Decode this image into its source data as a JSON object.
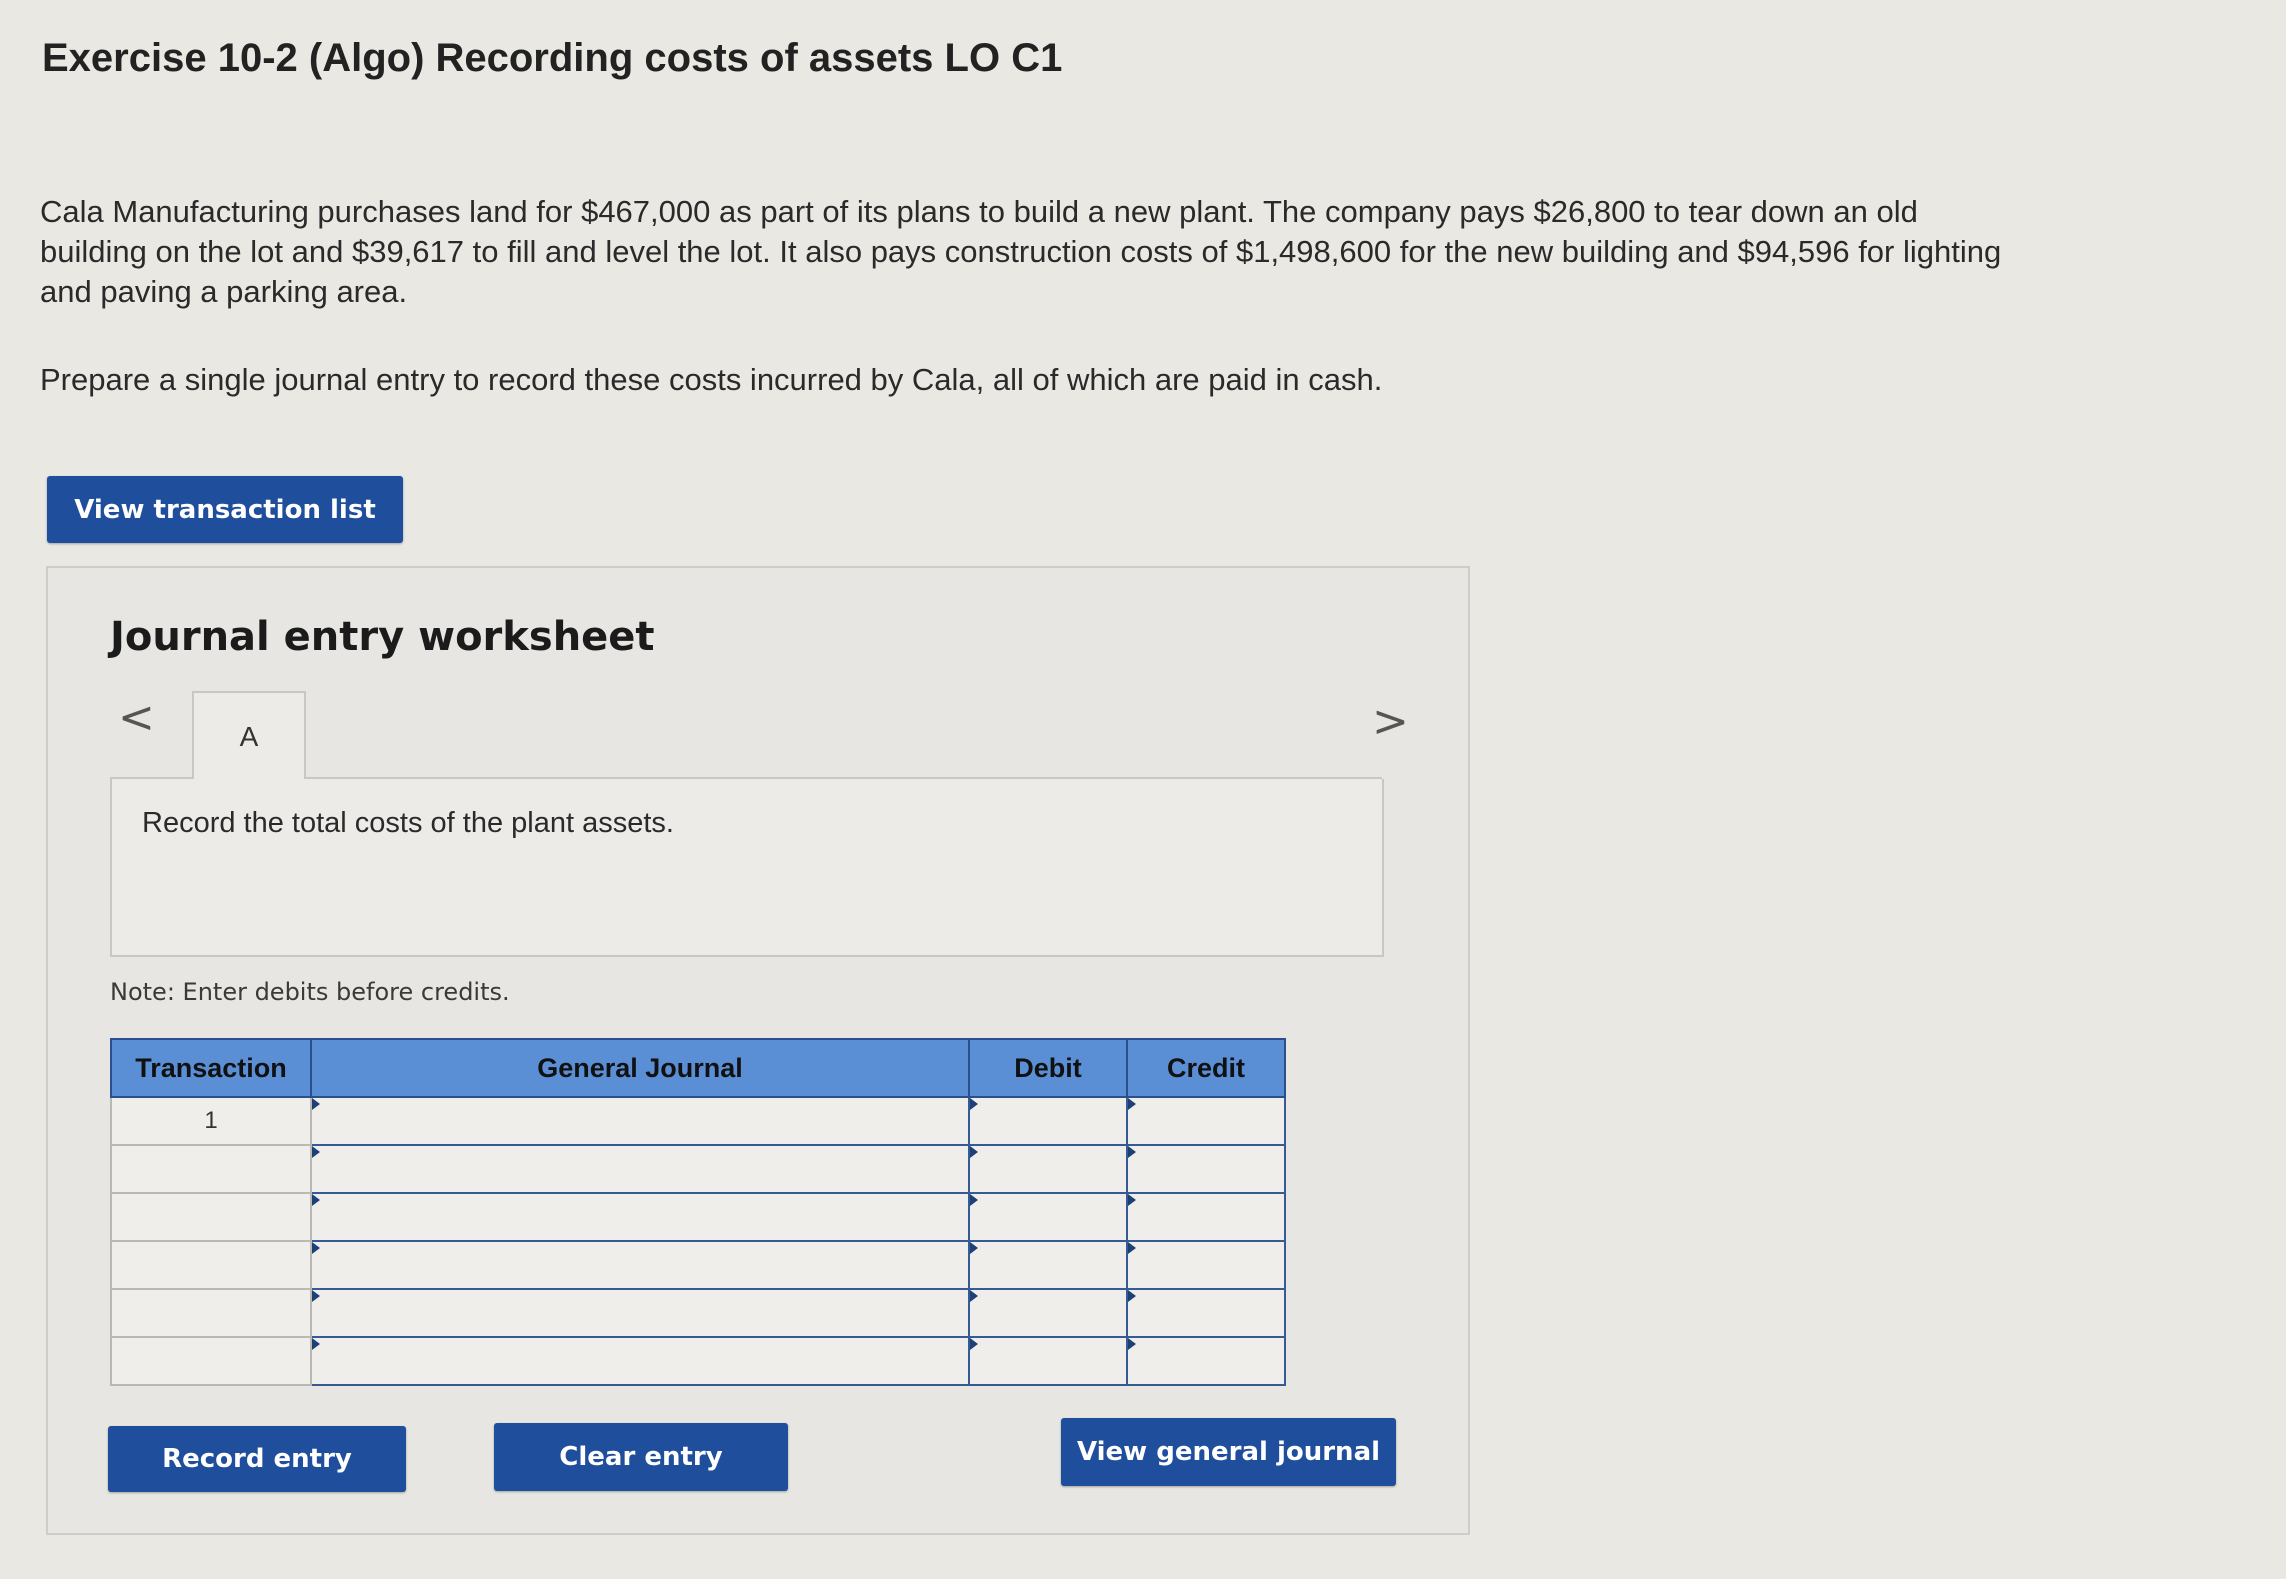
{
  "header": {
    "title": "Exercise 10-2 (Algo) Recording costs of assets LO C1"
  },
  "problem": {
    "text": "Cala Manufacturing purchases land for $467,000 as part of its plans to build a new plant. The company pays $26,800 to tear down an old building on the lot and $39,617 to fill and level the lot. It also pays construction costs of $1,498,600 for the new building and $94,596 for lighting and paving a parking area.",
    "instruction": "Prepare a single journal entry to record these costs incurred by Cala, all of which are paid in cash."
  },
  "buttons": {
    "view_transaction_list": "View transaction list",
    "record_entry": "Record entry",
    "clear_entry": "Clear entry",
    "view_general_journal": "View general journal"
  },
  "worksheet": {
    "title": "Journal entry worksheet",
    "nav_prev": "<",
    "nav_next": ">",
    "tab_label": "A",
    "requirement": "Record the total costs of the plant assets.",
    "note": "Note: Enter debits before credits."
  },
  "journal": {
    "headers": {
      "transaction": "Transaction",
      "general_journal": "General Journal",
      "debit": "Debit",
      "credit": "Credit"
    },
    "rows": [
      {
        "transaction": "1",
        "account": "",
        "debit": "",
        "credit": ""
      },
      {
        "transaction": "",
        "account": "",
        "debit": "",
        "credit": ""
      },
      {
        "transaction": "",
        "account": "",
        "debit": "",
        "credit": ""
      },
      {
        "transaction": "",
        "account": "",
        "debit": "",
        "credit": ""
      },
      {
        "transaction": "",
        "account": "",
        "debit": "",
        "credit": ""
      },
      {
        "transaction": "",
        "account": "",
        "debit": "",
        "credit": ""
      }
    ]
  },
  "colors": {
    "button_blue": "#1f4e9c",
    "header_blue": "#5a8fd6",
    "background": "#e9e8e3"
  }
}
